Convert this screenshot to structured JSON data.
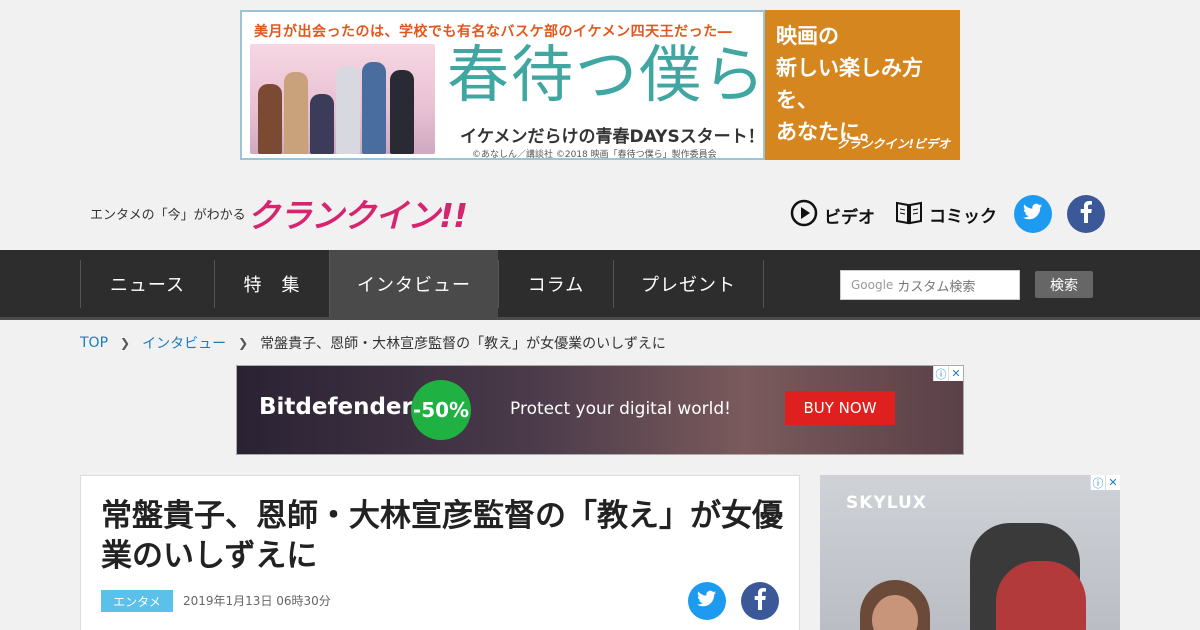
{
  "top_ad": {
    "tagline": "美月が出会ったのは、学校でも有名なバスケ部のイケメン四天王だった―",
    "title": "春待つ僕ら",
    "subtitle": "イケメンだらけの青春DAYSスタート！？",
    "copyright": "©あなしん／講談社 ©2018 映画「春待つ僕ら」製作委員会",
    "right_text": "映画の\n新しい楽しみ方を、\nあなたに。",
    "right_brand": "クランクイン!ビデオ"
  },
  "header": {
    "logo_caption": "エンタメの「今」がわかる",
    "logo_text": "クランクイン!!",
    "video_label": "ビデオ",
    "comic_label": "コミック"
  },
  "nav": {
    "items": [
      {
        "label": "ニュース"
      },
      {
        "label": "特　集"
      },
      {
        "label": "インタビュー"
      },
      {
        "label": "コラム"
      },
      {
        "label": "プレゼント"
      }
    ],
    "search_placeholder": "カスタム検索",
    "search_google": "Google",
    "search_button": "検索"
  },
  "breadcrumb": {
    "items": [
      "TOP",
      "インタビュー"
    ],
    "current": "常盤貴子、恩師・大林宣彦監督の「教え」が女優業のいしずえに"
  },
  "mid_ad": {
    "brand": "Bitdefender",
    "discount": "-50%",
    "slogan": "Protect your digital world!",
    "cta": "BUY NOW"
  },
  "article": {
    "title": "常盤貴子、恩師・大林宣彦監督の「教え」が女優業のいしずえに",
    "category": "エンタメ",
    "date": "2019年1月13日 06時30分"
  },
  "side_ad": {
    "brand": "SKYLUX"
  },
  "colors": {
    "nav_bg": "#2d2d2d",
    "twitter": "#1d9bf0",
    "facebook": "#3b5998",
    "logo": "#d6246e",
    "category": "#5bc0ea",
    "link": "#1f7bc0"
  }
}
